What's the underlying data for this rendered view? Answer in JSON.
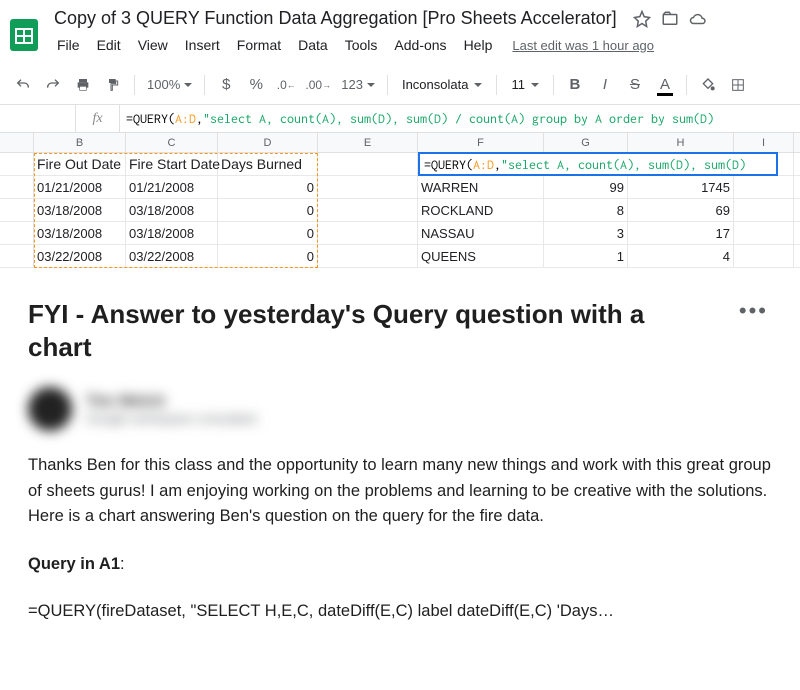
{
  "doc": {
    "title": "Copy of 3 QUERY Function Data Aggregation [Pro Sheets Accelerator]"
  },
  "menu": {
    "file": "File",
    "edit": "Edit",
    "view": "View",
    "insert": "Insert",
    "format": "Format",
    "data": "Data",
    "tools": "Tools",
    "addons": "Add-ons",
    "help": "Help",
    "last_edit": "Last edit was 1 hour ago"
  },
  "toolbar": {
    "zoom": "100%",
    "currency": "$",
    "percent": "%",
    "dec_dec": ".0",
    "inc_dec": ".00",
    "more_formats": "123",
    "font": "Inconsolata",
    "font_size": "11",
    "bold": "B",
    "italic": "I",
    "strike": "S",
    "text_color": "A"
  },
  "formula_bar": {
    "fx": "fx",
    "prefix": "=QUERY(",
    "range": "A:D",
    "comma": ",",
    "str": "\"select A, count(A), sum(D), sum(D) / count(A) group by A order by sum(D)"
  },
  "columns": {
    "B": "B",
    "C": "C",
    "D": "D",
    "E": "E",
    "F": "F",
    "G": "G",
    "H": "H",
    "I": "I"
  },
  "headers": {
    "B": "Fire Out Date",
    "C": "Fire Start Date",
    "D": "Days Burned"
  },
  "cell_formula_overlay": "=QUERY(A:D,\"select A, count(A), sum(D), sum(D)",
  "rows": [
    {
      "B": "01/21/2008",
      "C": "01/21/2008",
      "D": "0",
      "F": "WARREN",
      "G": "99",
      "H": "1745"
    },
    {
      "B": "03/18/2008",
      "C": "03/18/2008",
      "D": "0",
      "F": "ROCKLAND",
      "G": "8",
      "H": "69"
    },
    {
      "B": "03/18/2008",
      "C": "03/18/2008",
      "D": "0",
      "F": "NASSAU",
      "G": "3",
      "H": "17"
    },
    {
      "B": "03/22/2008",
      "C": "03/22/2008",
      "D": "0",
      "F": "QUEENS",
      "G": "1",
      "H": "4"
    }
  ],
  "article": {
    "title": "FYI - Answer to yesterday's Query question with a chart",
    "more": "•••",
    "author_name": "Tim Welch",
    "author_sub": "Google workspace consultant",
    "body1": "Thanks Ben for this class and the opportunity to learn many new things and work with this great group of sheets gurus! I am enjoying working on the problems and learning to be creative with the solutions. Here is a chart answering Ben's question on the query for the fire data.",
    "query_label": "Query in A1",
    "query_colon": ":",
    "query_text": "=QUERY(fireDataset, \"SELECT H,E,C, dateDiff(E,C) label dateDiff(E,C) 'Days…"
  }
}
